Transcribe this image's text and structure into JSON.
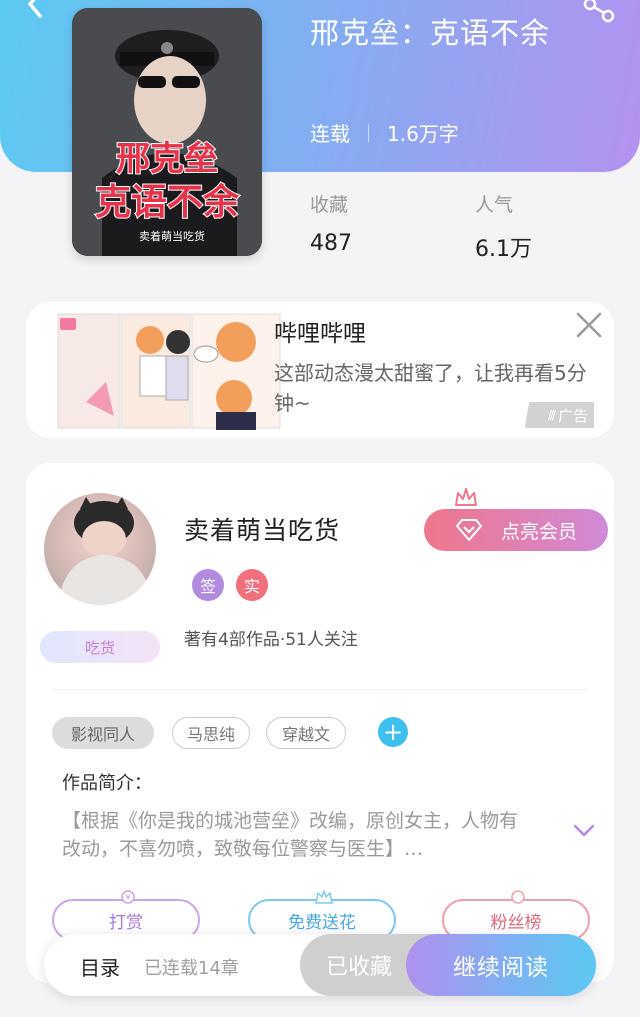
{
  "book": {
    "title": "邢克垒：克语不余",
    "status": "连载",
    "word_count": "1.6万字",
    "cover_title_line1": "邢克垒",
    "cover_title_line2": "克语不余",
    "cover_author": "卖着萌当吃货",
    "stats": {
      "favorites_label": "收藏",
      "favorites_value": "487",
      "popularity_label": "人气",
      "popularity_value": "6.1万"
    }
  },
  "ad": {
    "title": "哔哩哔哩",
    "description": "这部动态漫太甜蜜了，让我再看5分钟~",
    "badge": "广告"
  },
  "author": {
    "name": "卖着萌当吃货",
    "vip_button": "点亮会员",
    "badge_sign": "签",
    "badge_real": "实",
    "foodie_badge": "吃货",
    "works_info": "著有4部作品·51人关注"
  },
  "tags": [
    "影视同人",
    "马思纯",
    "穿越文"
  ],
  "intro": {
    "label": "作品简介：",
    "text": "【根据《你是我的城池营垒》改编，原创女主，人物有改动，不喜勿喷，致敬每位警察与医生】…"
  },
  "actions": {
    "tip": "打赏",
    "flower": "免费送花",
    "fans": "粉丝榜"
  },
  "bottom_bar": {
    "toc": "目录",
    "chapters": "已连载14章",
    "favorited": "已收藏",
    "continue": "继续阅读"
  },
  "colors": {
    "header_gradient_start": "#5ccbf2",
    "header_gradient_end": "#b392ef",
    "accent_blue": "#3dc0ee",
    "vip_pink": "#f0768a"
  }
}
